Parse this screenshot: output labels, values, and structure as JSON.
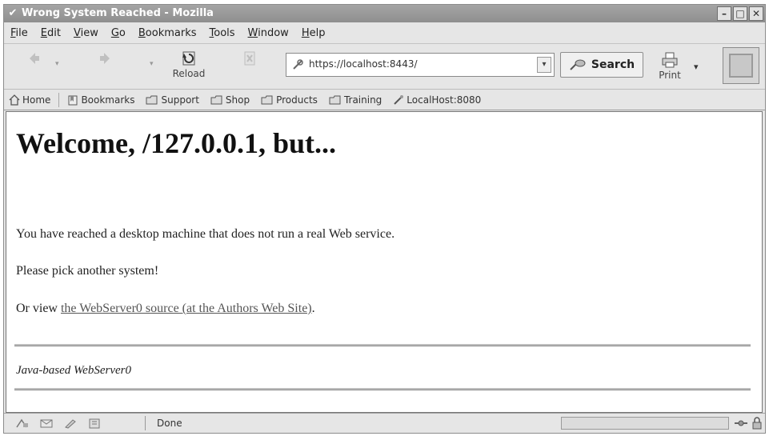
{
  "window": {
    "title": "Wrong System Reached - Mozilla"
  },
  "menu": {
    "items": [
      {
        "label": "File",
        "mnemonic": "F"
      },
      {
        "label": "Edit",
        "mnemonic": "E"
      },
      {
        "label": "View",
        "mnemonic": "V"
      },
      {
        "label": "Go",
        "mnemonic": "G"
      },
      {
        "label": "Bookmarks",
        "mnemonic": "B"
      },
      {
        "label": "Tools",
        "mnemonic": "T"
      },
      {
        "label": "Window",
        "mnemonic": "W"
      },
      {
        "label": "Help",
        "mnemonic": "H"
      }
    ]
  },
  "navbar": {
    "back_label": "",
    "forward_label": "",
    "reload_label": "Reload",
    "stop_label": "",
    "url": "https://localhost:8443/",
    "search_label": "Search",
    "print_label": "Print"
  },
  "personal_toolbar": {
    "items": [
      {
        "label": "Home",
        "icon": "home-icon"
      },
      {
        "label": "Bookmarks",
        "icon": "bookmarks-icon"
      },
      {
        "label": "Support",
        "icon": "folder-icon"
      },
      {
        "label": "Shop",
        "icon": "folder-icon"
      },
      {
        "label": "Products",
        "icon": "folder-icon"
      },
      {
        "label": "Training",
        "icon": "folder-icon"
      },
      {
        "label": "LocalHost:8080",
        "icon": "bookmark-link-icon"
      }
    ]
  },
  "page": {
    "heading": "Welcome, /127.0.0.1, but...",
    "paragraph1": "You have reached a desktop machine that does not run a real Web service.",
    "paragraph2": "Please pick another system!",
    "paragraph3_prefix": "Or view ",
    "paragraph3_link": "the WebServer0 source (at the Authors Web Site)",
    "paragraph3_suffix": ".",
    "footer": "Java-based WebServer0"
  },
  "statusbar": {
    "status_text": "Done"
  },
  "colors": {
    "title_bar": "#9a9a9a",
    "chrome": "#e6e6e6",
    "content_bg": "#ffffff",
    "link": "#555555"
  }
}
